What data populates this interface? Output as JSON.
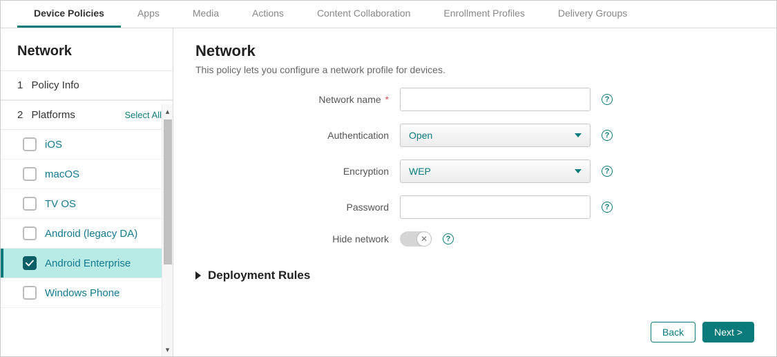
{
  "tabs": {
    "items": [
      "Device Policies",
      "Apps",
      "Media",
      "Actions",
      "Content Collaboration",
      "Enrollment Profiles",
      "Delivery Groups"
    ],
    "active_index": 0
  },
  "sidebar": {
    "title": "Network",
    "sections": {
      "policy_info": {
        "num": "1",
        "label": "Policy Info"
      },
      "platforms": {
        "num": "2",
        "label": "Platforms",
        "select_all": "Select All"
      }
    },
    "platforms": [
      {
        "label": "iOS",
        "checked": false,
        "selected": false
      },
      {
        "label": "macOS",
        "checked": false,
        "selected": false
      },
      {
        "label": "TV OS",
        "checked": false,
        "selected": false
      },
      {
        "label": "Android (legacy DA)",
        "checked": false,
        "selected": false
      },
      {
        "label": "Android Enterprise",
        "checked": true,
        "selected": true
      },
      {
        "label": "Windows Phone",
        "checked": false,
        "selected": false
      }
    ]
  },
  "main": {
    "title": "Network",
    "description": "This policy lets you configure a network profile for devices.",
    "fields": {
      "network_name": {
        "label": "Network name",
        "required": "*",
        "value": ""
      },
      "authentication": {
        "label": "Authentication",
        "value": "Open"
      },
      "encryption": {
        "label": "Encryption",
        "value": "WEP"
      },
      "password": {
        "label": "Password",
        "value": ""
      },
      "hide_network": {
        "label": "Hide network",
        "value": false
      }
    },
    "deployment_rules": "Deployment Rules"
  },
  "footer": {
    "back": "Back",
    "next": "Next >"
  }
}
